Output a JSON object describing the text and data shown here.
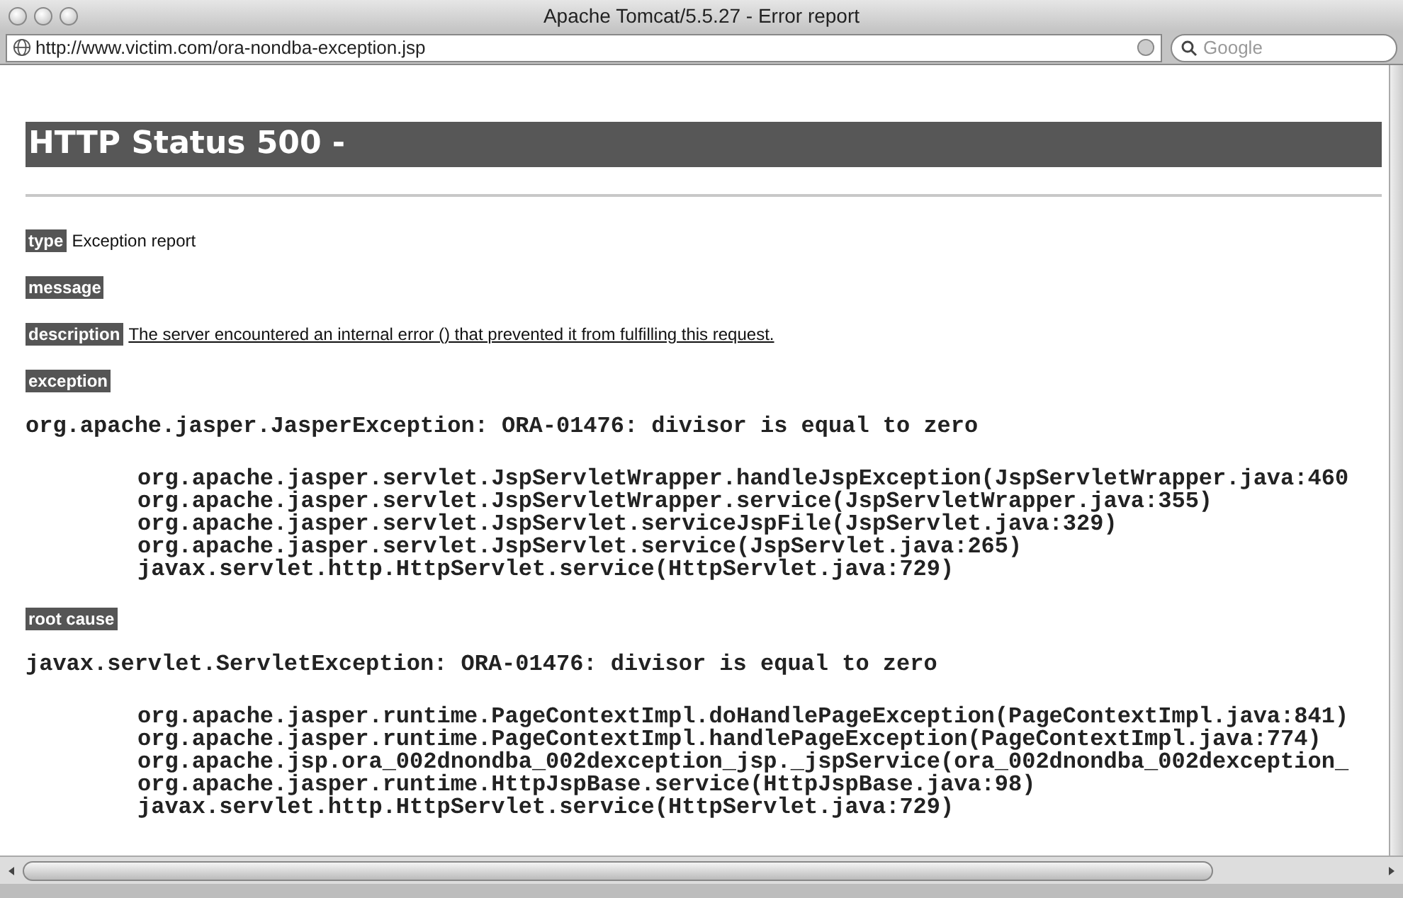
{
  "window": {
    "title": "Apache Tomcat/5.5.27 - Error report"
  },
  "address_bar": {
    "url": "http://www.victim.com/ora-nondba-exception.jsp"
  },
  "search": {
    "placeholder": "Google"
  },
  "page": {
    "heading": "HTTP Status 500 -",
    "fields": [
      {
        "label": "type",
        "text": "Exception report"
      },
      {
        "label": "message"
      },
      {
        "label": "description",
        "text": "The server encountered an internal error () that prevented it from fulfilling this request."
      }
    ],
    "sections": [
      {
        "label": "exception",
        "summary": "org.apache.jasper.JasperException: ORA-01476: divisor is equal to zero",
        "trace": [
          "org.apache.jasper.servlet.JspServletWrapper.handleJspException(JspServletWrapper.java:460",
          "org.apache.jasper.servlet.JspServletWrapper.service(JspServletWrapper.java:355)",
          "org.apache.jasper.servlet.JspServlet.serviceJspFile(JspServlet.java:329)",
          "org.apache.jasper.servlet.JspServlet.service(JspServlet.java:265)",
          "javax.servlet.http.HttpServlet.service(HttpServlet.java:729)"
        ]
      },
      {
        "label": "root cause",
        "summary": "javax.servlet.ServletException: ORA-01476: divisor is equal to zero",
        "trace": [
          "org.apache.jasper.runtime.PageContextImpl.doHandlePageException(PageContextImpl.java:841)",
          "org.apache.jasper.runtime.PageContextImpl.handlePageException(PageContextImpl.java:774)",
          "org.apache.jsp.ora_002dnondba_002dexception_jsp._jspService(ora_002dnondba_002dexception_",
          "org.apache.jasper.runtime.HttpJspBase.service(HttpJspBase.java:98)",
          "javax.servlet.http.HttpServlet.service(HttpServlet.java:729)"
        ]
      }
    ]
  }
}
